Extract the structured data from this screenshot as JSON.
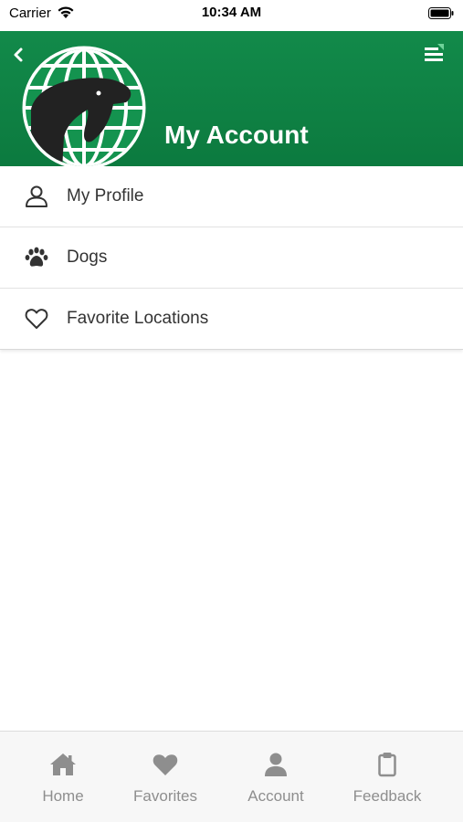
{
  "status_bar": {
    "carrier": "Carrier",
    "time": "10:34 AM"
  },
  "header": {
    "title": "My Account"
  },
  "menu": {
    "items": [
      {
        "label": "My Profile",
        "icon": "user-outline-icon"
      },
      {
        "label": "Dogs",
        "icon": "paw-icon"
      },
      {
        "label": "Favorite Locations",
        "icon": "heart-outline-icon"
      }
    ]
  },
  "tab_bar": {
    "tabs": [
      {
        "label": "Home",
        "icon": "home-icon"
      },
      {
        "label": "Favorites",
        "icon": "heart-icon"
      },
      {
        "label": "Account",
        "icon": "person-icon"
      },
      {
        "label": "Feedback",
        "icon": "clipboard-icon"
      }
    ]
  },
  "colors": {
    "header_green": "#0e8244",
    "tab_inactive": "#8e8e8e",
    "text": "#333333"
  }
}
